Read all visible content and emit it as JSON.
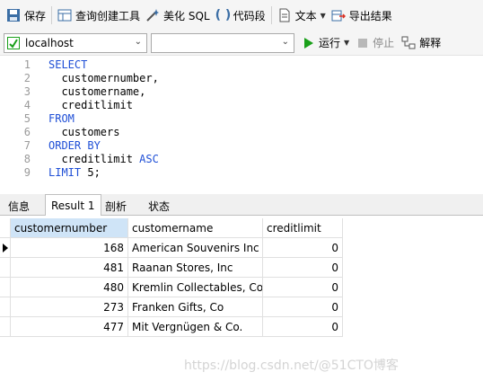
{
  "toolbar": {
    "save": "保存",
    "query_builder": "查询创建工具",
    "beautify": "美化 SQL",
    "snippet": "代码段",
    "text": "文本",
    "export": "导出结果"
  },
  "connection": {
    "selected": "localhost",
    "database": "",
    "run": "运行",
    "stop": "停止",
    "explain": "解释"
  },
  "editor": {
    "lines": [
      {
        "num": "1",
        "kw": "SELECT",
        "text": ""
      },
      {
        "num": "2",
        "kw": "",
        "text": "  customernumber,"
      },
      {
        "num": "3",
        "kw": "",
        "text": "  customername,"
      },
      {
        "num": "4",
        "kw": "",
        "text": "  creditlimit"
      },
      {
        "num": "5",
        "kw": "FROM",
        "text": ""
      },
      {
        "num": "6",
        "kw": "",
        "text": "  customers"
      },
      {
        "num": "7",
        "kw": "ORDER BY",
        "text": ""
      },
      {
        "num": "8",
        "kw": "",
        "text": "  creditlimit ",
        "kw2": "ASC"
      },
      {
        "num": "9",
        "kw": "LIMIT",
        "text": " 5;"
      }
    ]
  },
  "tabs": [
    "信息",
    "Result 1",
    "剖析",
    "状态"
  ],
  "results": {
    "columns": [
      "customernumber",
      "customername",
      "creditlimit"
    ],
    "rows": [
      [
        "168",
        "American Souvenirs Inc",
        "0"
      ],
      [
        "481",
        "Raanan Stores, Inc",
        "0"
      ],
      [
        "480",
        "Kremlin Collectables, Co.",
        "0"
      ],
      [
        "273",
        "Franken Gifts, Co",
        "0"
      ],
      [
        "477",
        "Mit Vergnügen & Co.",
        "0"
      ]
    ]
  },
  "watermark": "https://blog.csdn.net/@51CTO博客",
  "colors": {
    "keyword": "#1f4fd6",
    "selected_header": "#cfe4f7",
    "run_green": "#1aa01a"
  }
}
